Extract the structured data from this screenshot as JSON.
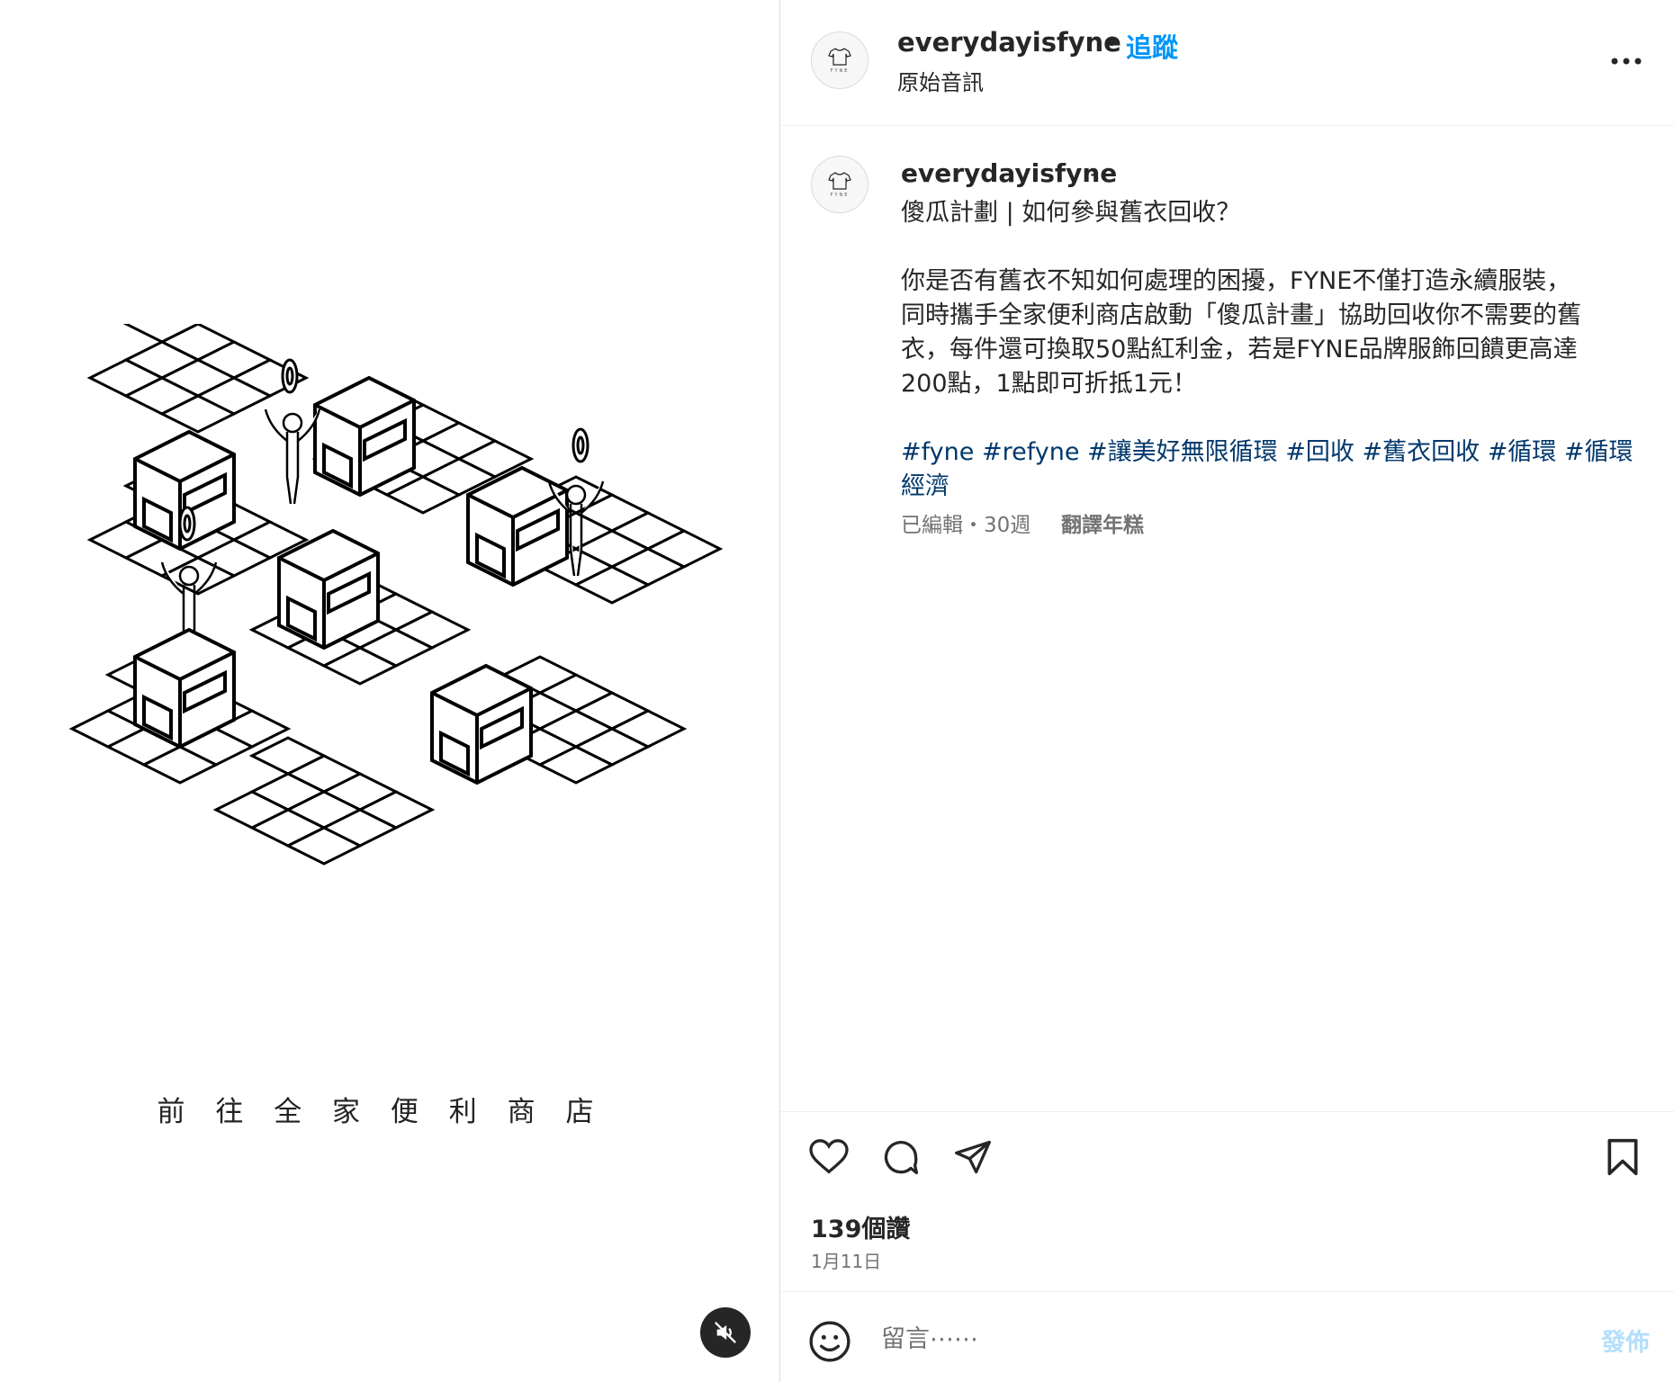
{
  "media": {
    "caption_text": "前 往 全 家 便 利 商 店"
  },
  "header": {
    "username": "everydayisfyne",
    "separator": "•",
    "follow_label": "追蹤",
    "audio_label": "原始音訊"
  },
  "post_caption": {
    "username": "everydayisfyne",
    "dash": "-",
    "lines": [
      "傻瓜計劃 | 如何參與舊衣回收？",
      "你是否有舊衣不知如何處理的困擾，FYNE不僅打造永續服裝，",
      "同時攜手全家便利商店啟動「傻瓜計畫」協助回收你不需要的舊",
      "衣，每件還可換取50點紅利金，若是FYNE品牌服飾回饋更高達",
      "200點，1點即可折抵1元！"
    ],
    "hashtags": {
      "h1": "#fyne",
      "h2": "#refyne",
      "h3": "#讓美好無限循環",
      "h4": "#回收",
      "h5": "#舊衣回收",
      "h6": "#循環",
      "h7": "#循環",
      "h7_cont": "經濟"
    },
    "meta": "已編輯・30週",
    "translate_label": "翻譯年糕"
  },
  "actions": {
    "likes": "139個讚",
    "date": "1月11日"
  },
  "comment": {
    "placeholder": "留言⋯⋯",
    "post_label": "發佈"
  },
  "avatar": {
    "brand_text": "FYNE"
  },
  "colors": {
    "follow_blue": "#0095f6",
    "hashtag_blue": "#00376b",
    "post_disabled": "#b2dffc",
    "muted_text": "#737373"
  }
}
